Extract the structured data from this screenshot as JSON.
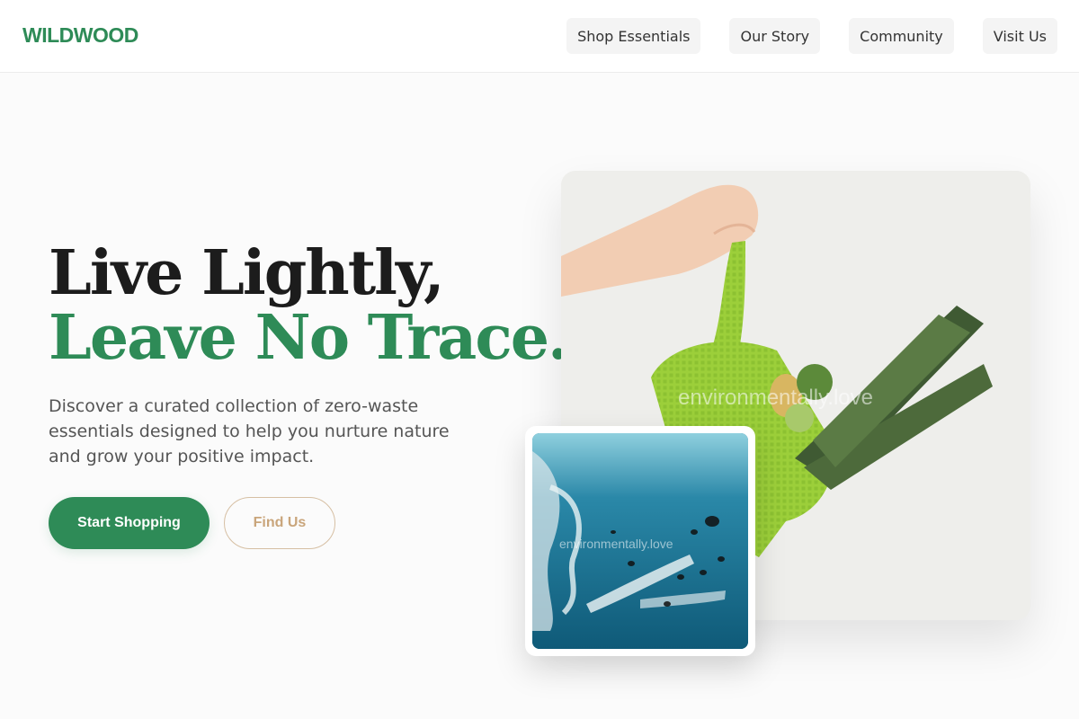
{
  "brand": {
    "name": "WILDWOOD",
    "color": "#2e8b57"
  },
  "nav": {
    "items": [
      {
        "label": "Shop Essentials"
      },
      {
        "label": "Our Story"
      },
      {
        "label": "Community"
      },
      {
        "label": "Visit Us"
      }
    ]
  },
  "hero": {
    "title_line1": "Live Lightly,",
    "title_line2": "Leave No Trace.",
    "description": "Discover a curated collection of zero-waste essentials designed to help you nurture nature and grow your positive impact.",
    "primary_cta": "Start Shopping",
    "secondary_cta": "Find Us",
    "accent_color": "#2e8b57",
    "secondary_color": "#c9a57b"
  },
  "images": {
    "main": {
      "subject": "hand holding green mesh produce bag with leeks",
      "watermark": "environmentally.love"
    },
    "inset": {
      "subject": "plastic pollution underwater with fish",
      "watermark": "environmentally.love"
    }
  }
}
